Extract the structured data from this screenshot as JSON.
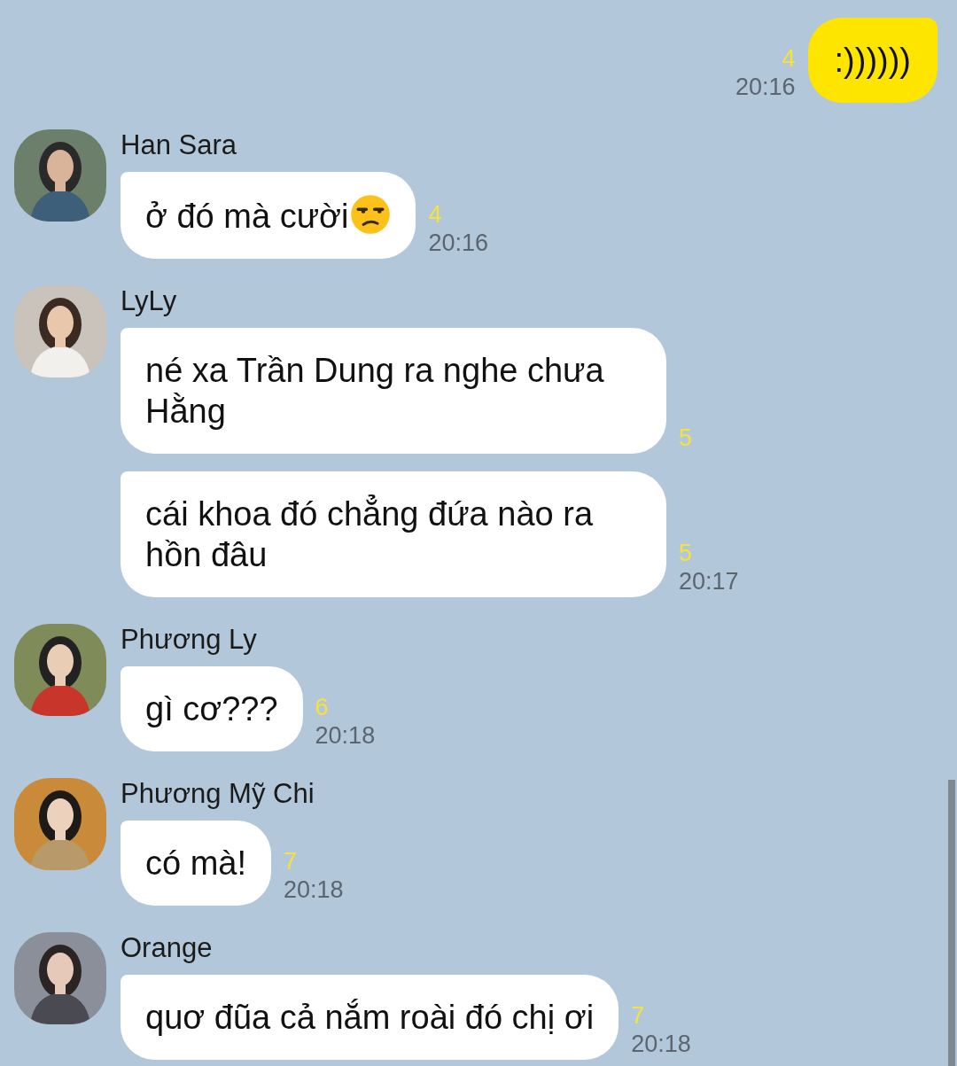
{
  "messages": [
    {
      "kind": "outgoing",
      "bubbles": [
        {
          "text": ":))))))",
          "unread": "4",
          "time": "20:16"
        }
      ]
    },
    {
      "kind": "incoming",
      "sender": "Han Sara",
      "bubbles": [
        {
          "text": "ở đó mà cười",
          "trailing_emoji": true,
          "unread": "4",
          "time": "20:16"
        }
      ]
    },
    {
      "kind": "incoming",
      "sender": "LyLy",
      "bubbles": [
        {
          "text": "né xa Trần Dung ra nghe chưa Hằng",
          "unread": "5"
        },
        {
          "text": "cái khoa đó chẳng đứa nào ra hồn đâu",
          "unread": "5",
          "time": "20:17"
        }
      ]
    },
    {
      "kind": "incoming",
      "sender": "Phương Ly",
      "bubbles": [
        {
          "text": "gì cơ???",
          "unread": "6",
          "time": "20:18"
        }
      ]
    },
    {
      "kind": "incoming",
      "sender": "Phương Mỹ Chi",
      "bubbles": [
        {
          "text": "có mà!",
          "unread": "7",
          "time": "20:18"
        }
      ]
    },
    {
      "kind": "incoming",
      "sender": "Orange",
      "bubbles": [
        {
          "text": "quơ đũa cả nắm roài đó chị ơi",
          "unread": "7",
          "time": "20:18"
        }
      ]
    }
  ]
}
